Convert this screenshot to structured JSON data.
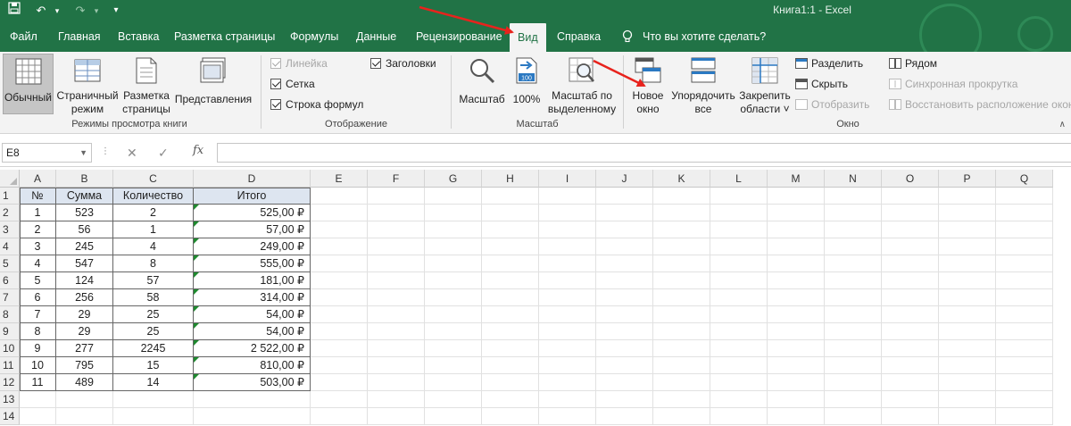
{
  "window": {
    "title": "Книга1:1  -  Excel"
  },
  "tabs": [
    {
      "label": "Файл",
      "active": false
    },
    {
      "label": "Главная",
      "active": false
    },
    {
      "label": "Вставка",
      "active": false
    },
    {
      "label": "Разметка страницы",
      "active": false
    },
    {
      "label": "Формулы",
      "active": false
    },
    {
      "label": "Данные",
      "active": false
    },
    {
      "label": "Рецензирование",
      "active": false
    },
    {
      "label": "Вид",
      "active": true
    },
    {
      "label": "Справка",
      "active": false
    }
  ],
  "tell_me": "Что вы хотите сделать?",
  "ribbon": {
    "views": {
      "normal": "Обычный",
      "page_break_1": "Страничный",
      "page_break_2": "режим",
      "page_layout_1": "Разметка",
      "page_layout_2": "страницы",
      "custom_views": "Представления",
      "group_label": "Режимы просмотра книги"
    },
    "show": {
      "ruler": "Линейка",
      "gridlines": "Сетка",
      "formula_bar": "Строка формул",
      "headings": "Заголовки",
      "group_label": "Отображение"
    },
    "zoom": {
      "zoom": "Масштаб",
      "zoom100": "100%",
      "zoom_sel_1": "Масштаб по",
      "zoom_sel_2": "выделенному",
      "group_label": "Масштаб"
    },
    "window": {
      "new_1": "Новое",
      "new_2": "окно",
      "arrange_1": "Упорядочить",
      "arrange_2": "все",
      "freeze_1": "Закрепить",
      "freeze_2": "области ˅",
      "split": "Разделить",
      "hide": "Скрыть",
      "unhide": "Отобразить",
      "side_by_side": "Рядом",
      "sync_scroll": "Синхронная прокрутка",
      "reset_pos": "Восстановить расположение окон",
      "group_label": "Окно"
    }
  },
  "formula_bar": {
    "name_box": "E8",
    "formula": ""
  },
  "columns": [
    "A",
    "B",
    "C",
    "D",
    "E",
    "F",
    "G",
    "H",
    "I",
    "J",
    "K",
    "L",
    "M",
    "N",
    "O",
    "P",
    "Q"
  ],
  "rows": [
    "1",
    "2",
    "3",
    "4",
    "5",
    "6",
    "7",
    "8",
    "9",
    "10",
    "11",
    "12",
    "13",
    "14"
  ],
  "table": {
    "headers": [
      "№",
      "Сумма",
      "Количество",
      "Итого"
    ],
    "data": [
      [
        "1",
        "523",
        "2",
        "525,00 ₽"
      ],
      [
        "2",
        "56",
        "1",
        "57,00 ₽"
      ],
      [
        "3",
        "245",
        "4",
        "249,00 ₽"
      ],
      [
        "4",
        "547",
        "8",
        "555,00 ₽"
      ],
      [
        "5",
        "124",
        "57",
        "181,00 ₽"
      ],
      [
        "6",
        "256",
        "58",
        "314,00 ₽"
      ],
      [
        "7",
        "29",
        "25",
        "54,00 ₽"
      ],
      [
        "8",
        "29",
        "25",
        "54,00 ₽"
      ],
      [
        "9",
        "277",
        "2245",
        "2 522,00 ₽"
      ],
      [
        "10",
        "795",
        "15",
        "810,00 ₽"
      ],
      [
        "11",
        "489",
        "14",
        "503,00 ₽"
      ]
    ]
  },
  "colors": {
    "accent": "#217346",
    "annotation_arrow": "#e8231d",
    "header_fill": "#dde5f0"
  }
}
